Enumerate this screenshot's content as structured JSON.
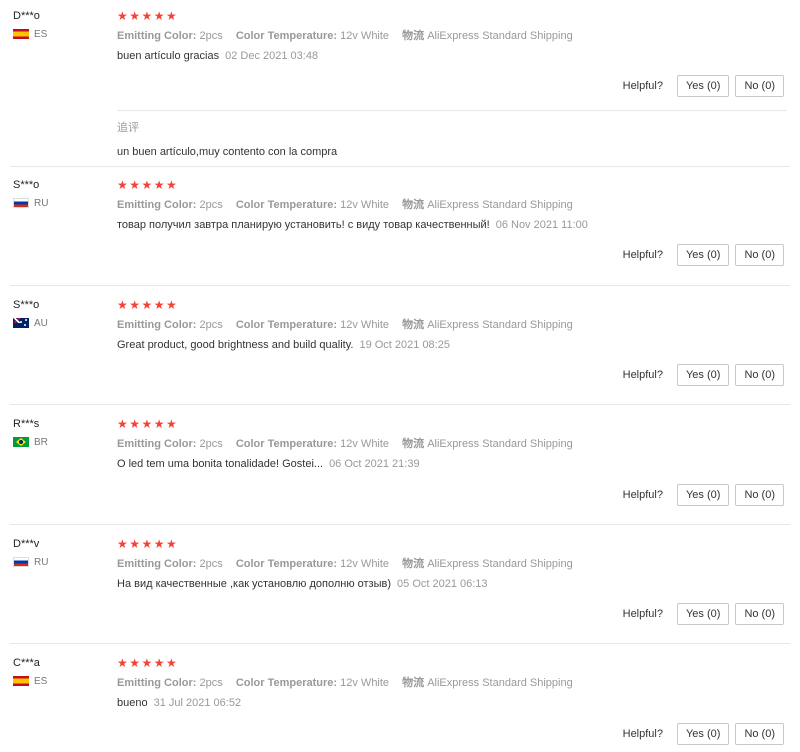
{
  "helpful": {
    "label": "Helpful?",
    "yes": "Yes (0)",
    "no": "No (0)"
  },
  "stars": "★★★★★",
  "attribute_keys": {
    "emitting_color": "Emitting Color:",
    "color_temperature": "Color Temperature:",
    "shipping": "物流"
  },
  "reviews": [
    {
      "user": "D***o",
      "country": "ES",
      "flag": "es-flag-icon",
      "emitting_color": "2pcs",
      "color_temperature": "12v White",
      "shipping": "AliExpress Standard Shipping",
      "text": "buen artículo gracias",
      "date": "02 Dec 2021 03:48",
      "additional_label": "追评",
      "additional_text": "un buen artículo,muy contento con la compra"
    },
    {
      "user": "S***o",
      "country": "RU",
      "flag": "ru-flag-icon",
      "emitting_color": "2pcs",
      "color_temperature": "12v White",
      "shipping": "AliExpress Standard Shipping",
      "text": "товар получил завтра планирую установить! с виду товар качественный!",
      "date": "06 Nov 2021 11:00"
    },
    {
      "user": "S***o",
      "country": "AU",
      "flag": "au-flag-icon",
      "emitting_color": "2pcs",
      "color_temperature": "12v White",
      "shipping": "AliExpress Standard Shipping",
      "text": "Great product, good brightness and build quality.",
      "date": "19 Oct 2021 08:25"
    },
    {
      "user": "R***s",
      "country": "BR",
      "flag": "br-flag-icon",
      "emitting_color": "2pcs",
      "color_temperature": "12v White",
      "shipping": "AliExpress Standard Shipping",
      "text": "O led tem uma bonita tonalidade! Gostei...",
      "date": "06 Oct 2021 21:39"
    },
    {
      "user": "D***v",
      "country": "RU",
      "flag": "ru-flag-icon",
      "emitting_color": "2pcs",
      "color_temperature": "12v White",
      "shipping": "AliExpress Standard Shipping",
      "text": "На вид качественные ,как установлю дополню отзыв)",
      "date": "05 Oct 2021 06:13"
    },
    {
      "user": "C***a",
      "country": "ES",
      "flag": "es-flag-icon",
      "emitting_color": "2pcs",
      "color_temperature": "12v White",
      "shipping": "AliExpress Standard Shipping",
      "text": "bueno",
      "date": "31 Jul 2021 06:52"
    }
  ]
}
